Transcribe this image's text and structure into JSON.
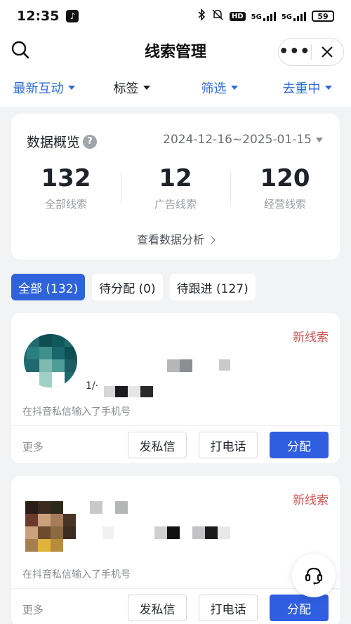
{
  "status": {
    "time": "12:35",
    "network": "5G",
    "hd": "HD",
    "battery": "59"
  },
  "header": {
    "title": "线索管理"
  },
  "filters": [
    {
      "label": "最新互动",
      "color": "#2f6bd6"
    },
    {
      "label": "标签",
      "color": "#1f2329"
    },
    {
      "label": "筛选",
      "color": "#2f6bd6"
    },
    {
      "label": "去重中",
      "color": "#2f6bd6"
    }
  ],
  "overview": {
    "title": "数据概览",
    "date_range": "2024-12-16~2025-01-15",
    "stats": [
      {
        "value": "132",
        "label": "全部线索"
      },
      {
        "value": "12",
        "label": "广告线索"
      },
      {
        "value": "120",
        "label": "经营线索"
      }
    ],
    "link": "查看数据分析"
  },
  "tabs": [
    {
      "label": "全部 (132)",
      "active": true
    },
    {
      "label": "待分配 (0)",
      "active": false
    },
    {
      "label": "待跟进 (127)",
      "active": false
    }
  ],
  "leads": [
    {
      "tag": "新线索",
      "partial_phone": "1/·",
      "description": "在抖音私信输入了手机号",
      "more": "更多",
      "actions": {
        "message": "发私信",
        "call": "打电话",
        "assign": "分配"
      }
    },
    {
      "tag": "新线索",
      "description": "在抖音私信输入了手机号",
      "more": "更多",
      "actions": {
        "message": "发私信",
        "call": "打电话",
        "assign": "分配"
      }
    }
  ],
  "icons": {
    "search": "search-icon",
    "more": "more-dots-icon",
    "close": "close-icon",
    "help": "question-icon",
    "customer_service": "headset-icon"
  },
  "colors": {
    "accent": "#2f63d9",
    "new_lead": "#d05656"
  }
}
